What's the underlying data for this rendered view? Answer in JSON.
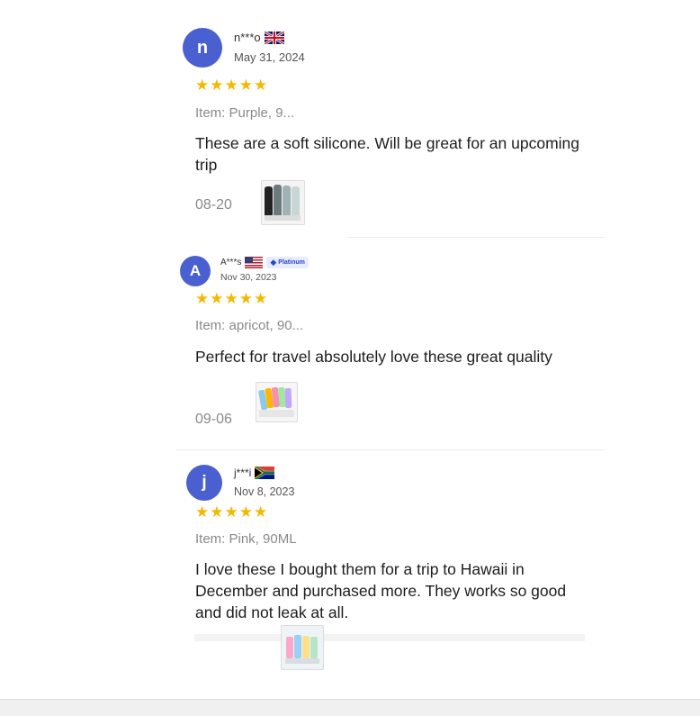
{
  "reviews": [
    {
      "avatar_letter": "n",
      "username": "n***o",
      "flag_icon": "uk-flag-icon",
      "date": "May 31, 2024",
      "stars": "★★★★★",
      "item": "Item: Purple, 9...",
      "text": "These are a soft silicone. Will be great for an upcoming trip",
      "review_date": "08-20",
      "thumbnail": "product-photo-gray-bottles"
    },
    {
      "avatar_letter": "A",
      "username": "A***s",
      "flag_icon": "us-flag-icon",
      "badge": "Platinum",
      "date": "Nov 30, 2023",
      "stars": "★★★★★",
      "item": "Item: apricot, 90...",
      "text": "Perfect for travel absolutely love these great quality",
      "review_date": "09-06",
      "thumbnail": "product-photo-colorful-bottles"
    },
    {
      "avatar_letter": "j",
      "username": "j***i",
      "flag_icon": "south-africa-flag-icon",
      "date": "Nov 8, 2023",
      "stars": "★★★★★",
      "item": "Item: Pink, 90ML",
      "text": "I love these I bought them for a trip to Hawaii in December and purchased more.  They works so good and did not leak at all.",
      "thumbnail": "product-photo-pastel-bottles"
    }
  ],
  "colors": {
    "avatar": "#4a5fd0",
    "star": "#f5b800",
    "muted_text": "#8a8a8a"
  }
}
